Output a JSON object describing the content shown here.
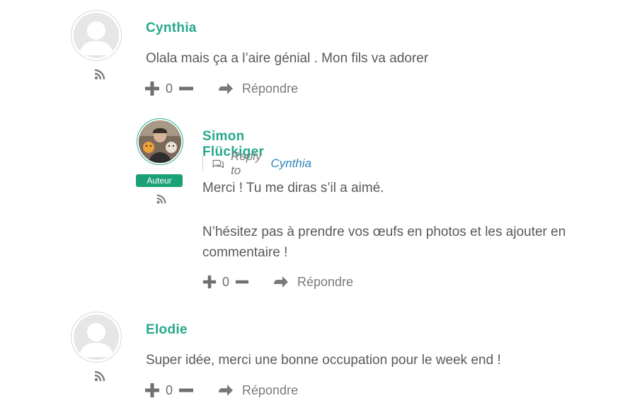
{
  "comments": [
    {
      "author": "Cynthia",
      "text": "Olala mais ça a l’aire génial . Mon fils va adorer",
      "votes": "0",
      "reply_label": "Répondre"
    },
    {
      "author": "Simon Flückiger",
      "badge": "Auteur",
      "reply_to_label": "Reply to",
      "reply_to_name": "Cynthia",
      "text_line1": "Merci ! Tu me diras s’il a aimé.",
      "text_line2": "N’hésitez pas à prendre vos œufs en photos et les ajouter en",
      "text_line3": "commentaire !",
      "votes": "0",
      "reply_label": "Répondre"
    },
    {
      "author": "Elodie",
      "text": "Super idée, merci une bonne occupation pour le week end !",
      "votes": "0",
      "reply_label": "Répondre"
    }
  ],
  "colors": {
    "author": "#26a98b",
    "badge": "#1aa178",
    "link": "#2f86b7"
  },
  "icons": [
    "default-avatar-icon",
    "rss-icon",
    "plus-icon",
    "minus-icon",
    "reply-arrow-icon",
    "comment-bubble-icon"
  ]
}
